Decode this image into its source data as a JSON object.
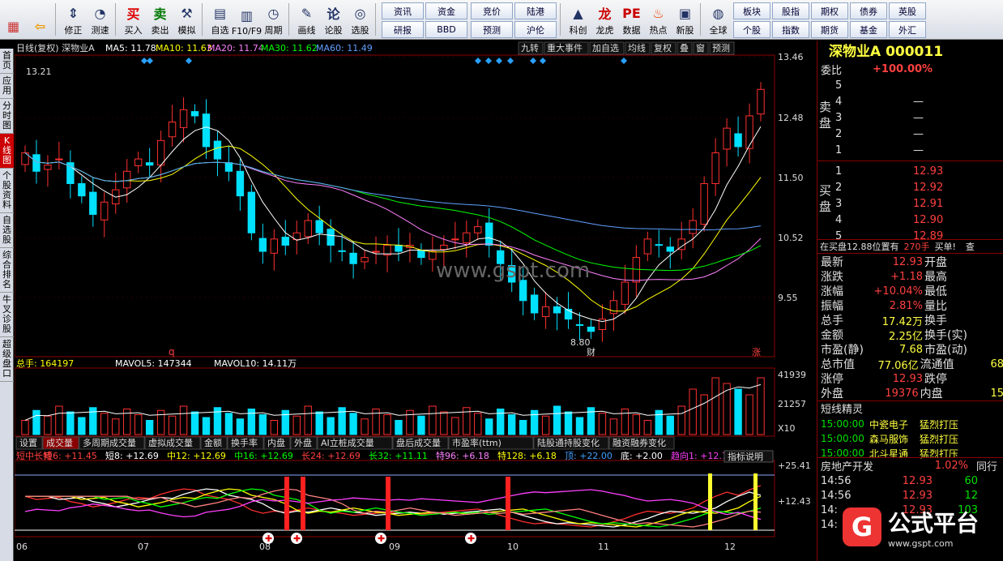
{
  "toolbar": {
    "buttons": [
      {
        "label": "",
        "icon": "grid-icon"
      },
      {
        "label": "",
        "icon": "back-icon"
      },
      {
        "label": "修正",
        "icon": "up-down-icon"
      },
      {
        "label": "测速",
        "icon": "clock-icon"
      },
      {
        "label": "买入",
        "icon": "buy-icon"
      },
      {
        "label": "卖出",
        "icon": "sell-icon"
      },
      {
        "label": "模拟",
        "icon": "hammer-icon"
      },
      {
        "label": "自选",
        "icon": "folder-icon"
      },
      {
        "label": "F10/F9",
        "icon": "doc-icon"
      },
      {
        "label": "周期",
        "icon": "period-icon"
      },
      {
        "label": "画线",
        "icon": "pen-icon"
      },
      {
        "label": "论股",
        "icon": "chat-icon"
      },
      {
        "label": "选股",
        "icon": "filter-icon"
      }
    ],
    "grid1": [
      "资讯",
      "资金",
      "研报",
      "BBD"
    ],
    "grid2": [
      "竞价",
      "陆港",
      "预测",
      "沪伦"
    ],
    "buttons2": [
      {
        "label": "科创",
        "icon": "chart-icon"
      },
      {
        "label": "龙虎",
        "icon": "tiger-icon"
      },
      {
        "label": "数据",
        "icon": "pe-icon"
      },
      {
        "label": "热点",
        "icon": "fire-icon"
      },
      {
        "label": "新股",
        "icon": "new-icon"
      },
      {
        "label": "全球",
        "icon": "globe-icon"
      }
    ],
    "grid3": [
      "板块",
      "股指",
      "期权",
      "债券",
      "英股",
      "个股",
      "指数",
      "期货",
      "基金",
      "外汇"
    ]
  },
  "lefttabs": [
    "首页",
    "应用",
    "分时图",
    "K线图",
    "个股资料",
    "自选股",
    "综合排名",
    "牛叉诊股",
    "超级盘口"
  ],
  "kline": {
    "header_left": "日线(复权) 深物业A",
    "ma": [
      {
        "label": "MA5: 11.78",
        "color": "#ffffff"
      },
      {
        "label": "MA10: 11.63",
        "color": "#ffff00"
      },
      {
        "label": "MA20: 11.74",
        "color": "#ff80ff"
      },
      {
        "label": "MA30: 11.62",
        "color": "#00ff00"
      },
      {
        "label": "MA60: 11.49",
        "color": "#60a0ff"
      }
    ],
    "header_right": [
      "九转",
      "重大事件",
      "加自选",
      "均线",
      "复权",
      "叠",
      "窗",
      "预测"
    ],
    "price_axis": [
      "13.46",
      "12.48",
      "11.50",
      "10.52",
      "9.55"
    ],
    "high_label": "13.21",
    "low_label": "8.80",
    "mark_q": "q",
    "mark_cai": "财",
    "mark_zhang": "涨",
    "watermark": "www.gspt.com"
  },
  "volume": {
    "header": [
      {
        "label": "总手: 164197",
        "color": "#ffff00"
      },
      {
        "label": "MAVOL5: 147344",
        "color": "#ffffff"
      },
      {
        "label": "MAVOL10: 14.11万",
        "color": "#ffffff"
      }
    ],
    "axis": [
      "41939",
      "21257",
      "X10"
    ],
    "tabs": [
      "设置",
      "成交量",
      "多周期成交量",
      "虚拟成交量",
      "金额",
      "换手率",
      "内盘",
      "外盘",
      "AI立桩成交量",
      "盘后成交量",
      "市盈率(ttm)",
      "陆股通持股变化",
      "融资融券变化"
    ]
  },
  "indicator": {
    "labels": [
      {
        "t": "短中长特",
        "c": "#ff4040"
      },
      {
        "t": "短6: +11.45",
        "c": "#ff4040"
      },
      {
        "t": "短8: +12.69",
        "c": "#ffffff"
      },
      {
        "t": "中12: +12.69",
        "c": "#ffff00"
      },
      {
        "t": "中16: +12.69",
        "c": "#00ff00"
      },
      {
        "t": "长24: +12.69",
        "c": "#ff4040"
      },
      {
        "t": "长32: +11.11",
        "c": "#00ff00"
      },
      {
        "t": "特96: +6.18",
        "c": "#ff80ff"
      },
      {
        "t": "特128: +6.18",
        "c": "#ffff00"
      },
      {
        "t": "顶: +22.00",
        "c": "#40a0ff"
      },
      {
        "t": "底: +2.00",
        "c": "#ffffff"
      },
      {
        "t": "趋向1: +12.76",
        "c": "#ff40ff"
      }
    ],
    "explain": "指标说明",
    "axis": [
      "+25.41",
      "+12.43"
    ]
  },
  "dates": [
    "06",
    "07",
    "08",
    "09",
    "10",
    "11",
    "12"
  ],
  "quote": {
    "title": "深物业A 000011",
    "weibi_label": "委比",
    "weibi": "+100.00%",
    "sell_side_label": "卖盘",
    "buy_side_label": "买盘",
    "sell": [
      {
        "n": "5",
        "p": "",
        "v": ""
      },
      {
        "n": "4",
        "p": "—",
        "v": ""
      },
      {
        "n": "3",
        "p": "—",
        "v": ""
      },
      {
        "n": "2",
        "p": "—",
        "v": ""
      },
      {
        "n": "1",
        "p": "—",
        "v": ""
      }
    ],
    "buy": [
      {
        "n": "1",
        "p": "12.93",
        "v": ""
      },
      {
        "n": "2",
        "p": "12.92",
        "v": ""
      },
      {
        "n": "3",
        "p": "12.91",
        "v": ""
      },
      {
        "n": "4",
        "p": "12.90",
        "v": ""
      },
      {
        "n": "5",
        "p": "12.89",
        "v": ""
      }
    ],
    "notice": "在买盘12.88位置有",
    "notice_vol": "270手",
    "notice_tail": "买单!",
    "notice_extra": "查",
    "stats": [
      {
        "l": "最新",
        "v": "12.93",
        "l2": "开盘"
      },
      {
        "l": "涨跌",
        "v": "+1.18",
        "l2": "最高"
      },
      {
        "l": "涨幅",
        "v": "+10.04%",
        "l2": "最低"
      },
      {
        "l": "振幅",
        "v": "2.81%",
        "l2": "量比"
      },
      {
        "l": "总手",
        "v": "17.42万",
        "l2": "换手"
      },
      {
        "l": "金额",
        "v": "2.25亿",
        "l2": "换手(实)"
      },
      {
        "l": "市盈(静)",
        "v": "7.68",
        "l2": "市盈(动)"
      },
      {
        "l": "总市值",
        "v": "77.06亿",
        "l2": "流通值",
        "v2": "68"
      },
      {
        "l": "涨停",
        "v": "12.93",
        "l2": "跌停"
      },
      {
        "l": "外盘",
        "v": "19376",
        "l2": "内盘",
        "v2": "15"
      }
    ],
    "sprite_title": "短线精灵",
    "sprites": [
      {
        "t": "15:00:00",
        "n": "中瓷电子",
        "a": "猛烈打压"
      },
      {
        "t": "15:00:00",
        "n": "森马服饰",
        "a": "猛烈打压"
      },
      {
        "t": "15:00:00",
        "n": "北斗星通",
        "a": "猛烈打压"
      }
    ],
    "sector": "房地产开发",
    "sector_pct": "1.02%",
    "sector_tab": "同行",
    "ticks": [
      {
        "t": "14:56",
        "p": "12.93",
        "v": "60"
      },
      {
        "t": "14:56",
        "p": "12.93",
        "v": "12"
      },
      {
        "t": "14:",
        "p": "12.93",
        "v": "103"
      },
      {
        "t": "14:",
        "p": "",
        "v": ""
      }
    ]
  },
  "logo": {
    "main": "公式平台",
    "sub": "www.gspt.com"
  },
  "chart_data": {
    "type": "candlestick",
    "series_close_approx": [
      11.9,
      11.6,
      11.7,
      11.8,
      11.4,
      11.2,
      10.9,
      11.1,
      11.3,
      11.6,
      11.8,
      11.7,
      12.1,
      12.4,
      12.6,
      12.5,
      12.0,
      11.8,
      11.6,
      11.2,
      10.6,
      10.3,
      10.5,
      10.4,
      10.6,
      10.8,
      10.6,
      10.4,
      10.3,
      10.1,
      10.2,
      10.3,
      10.4,
      10.3,
      10.4,
      10.2,
      10.3,
      10.4,
      10.5,
      10.6,
      10.7,
      10.4,
      10.1,
      9.8,
      9.5,
      9.3,
      9.4,
      9.3,
      9.2,
      9.1,
      9.0,
      9.2,
      9.5,
      9.8,
      10.2,
      10.5,
      10.4,
      10.3,
      10.5,
      10.8,
      11.4,
      11.9,
      12.3,
      12.0,
      12.5,
      12.93
    ],
    "ylim": [
      8.8,
      13.46
    ]
  }
}
